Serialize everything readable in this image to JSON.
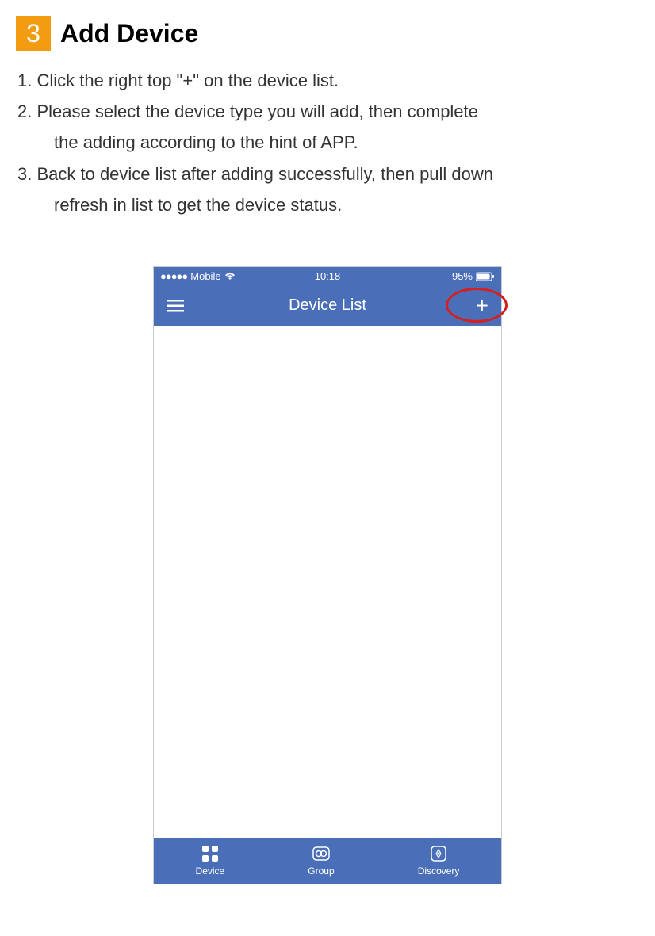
{
  "section": {
    "number": "3",
    "title": "Add Device"
  },
  "instructions": {
    "item1": "1. Click the right top \"+\" on the device list.",
    "item2": "2. Please select the device type you will add, then complete",
    "item2_cont": "the adding according to the hint of APP.",
    "item3": "3. Back to device list after adding successfully, then pull down",
    "item3_cont": "refresh in list to get the device status."
  },
  "phone": {
    "status": {
      "carrier": "Mobile",
      "time": "10:18",
      "battery": "95%"
    },
    "nav": {
      "title": "Device List"
    },
    "tabs": {
      "device": "Device",
      "group": "Group",
      "discovery": "Discovery"
    }
  }
}
